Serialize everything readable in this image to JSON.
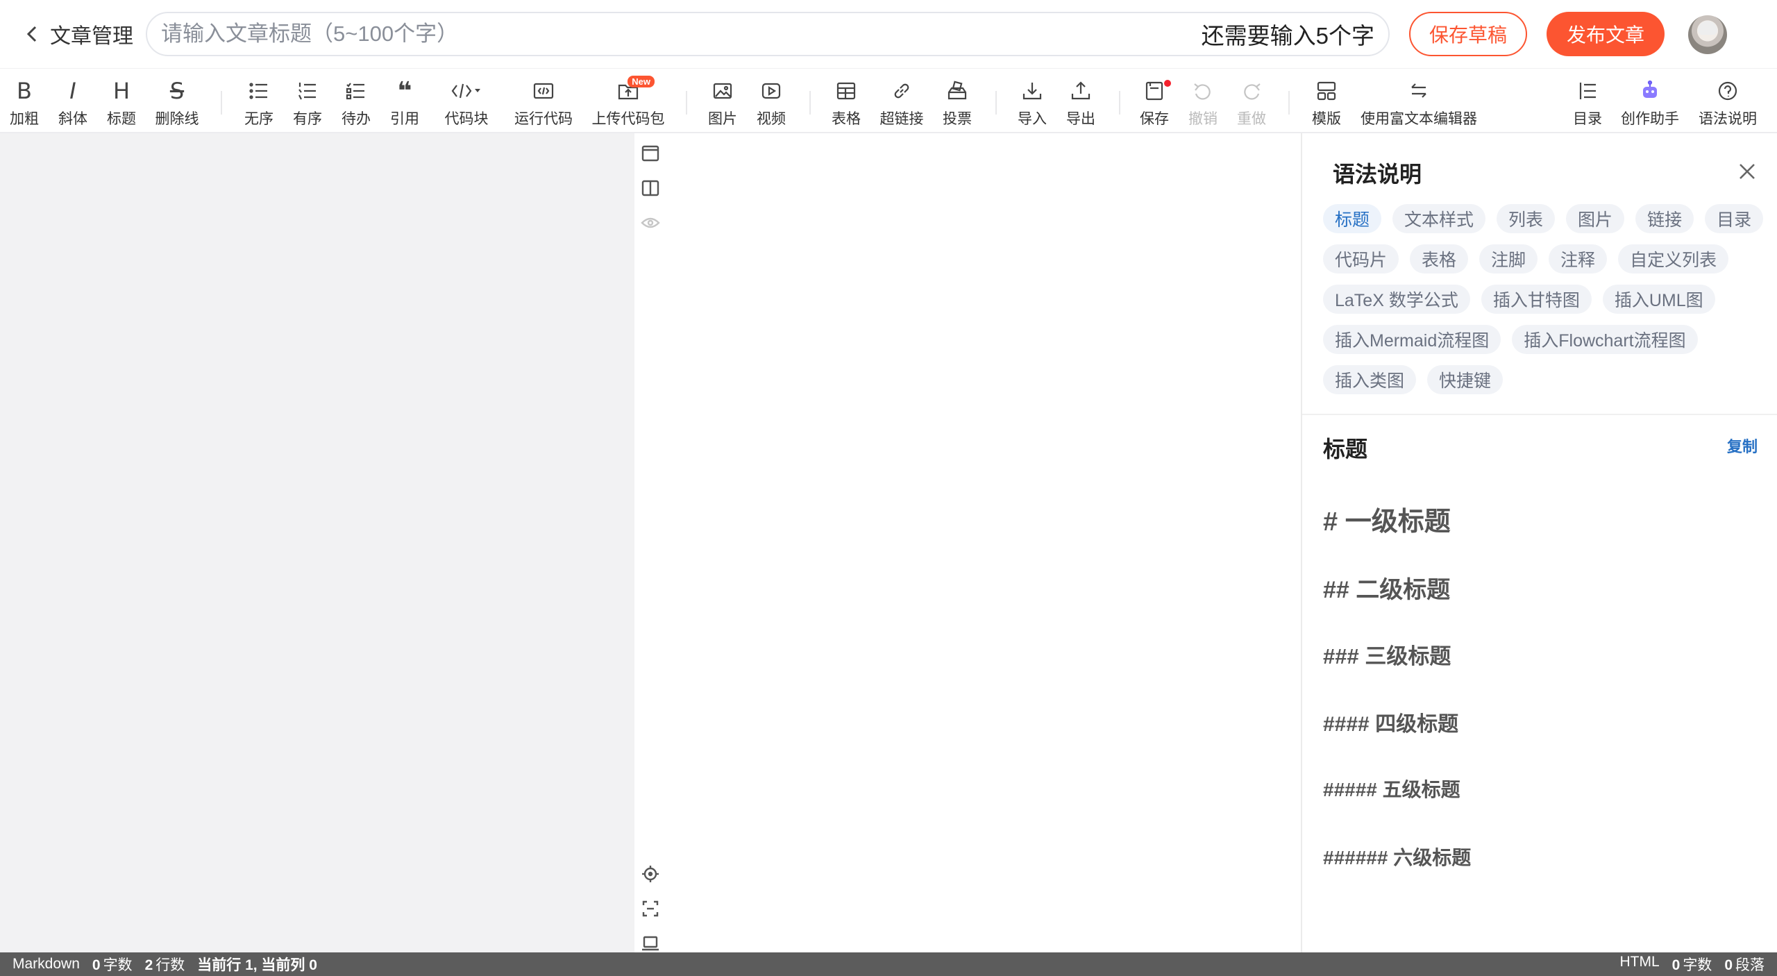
{
  "header": {
    "back_label": "文章管理",
    "title_placeholder": "请输入文章标题（5~100个字）",
    "title_value": "",
    "remain_hint": "还需要输入5个字",
    "save_draft_label": "保存草稿",
    "publish_label": "发布文章",
    "accent_color": "#fc5531"
  },
  "toolbar": {
    "bold": "加粗",
    "italic": "斜体",
    "heading": "标题",
    "strike": "删除线",
    "ul": "无序",
    "ol": "有序",
    "todo": "待办",
    "quote": "引用",
    "codeblock": "代码块",
    "runcode": "运行代码",
    "upload_code": "上传代码包",
    "new_badge": "New",
    "image": "图片",
    "video": "视频",
    "table": "表格",
    "link": "超链接",
    "vote": "投票",
    "import": "导入",
    "export": "导出",
    "save": "保存",
    "undo": "撤销",
    "redo": "重做",
    "template": "模版",
    "richtext": "使用富文本编辑器",
    "toc": "目录",
    "assistant": "创作助手",
    "syntax": "语法说明"
  },
  "panel": {
    "title": "语法说明",
    "tags": [
      "标题",
      "文本样式",
      "列表",
      "图片",
      "链接",
      "目录",
      "代码片",
      "表格",
      "注脚",
      "注释",
      "自定义列表",
      "LaTeX 数学公式",
      "插入甘特图",
      "插入UML图",
      "插入Mermaid流程图",
      "插入Flowchart流程图",
      "插入类图",
      "快捷键"
    ],
    "active_tag": "标题",
    "section_title": "标题",
    "copy_label": "复制",
    "headings": [
      "# 一级标题",
      "## 二级标题",
      "### 三级标题",
      "#### 四级标题",
      "##### 五级标题",
      "###### 六级标题"
    ]
  },
  "status": {
    "mode": "Markdown",
    "chars": "0",
    "chars_label": "字数",
    "lines": "2",
    "lines_label": "行数",
    "cursor": "当前行 1, 当前列 0",
    "html_label": "HTML",
    "html_chars": "0",
    "html_chars_label": "字数",
    "paragraphs": "0",
    "paragraphs_label": "段落"
  }
}
